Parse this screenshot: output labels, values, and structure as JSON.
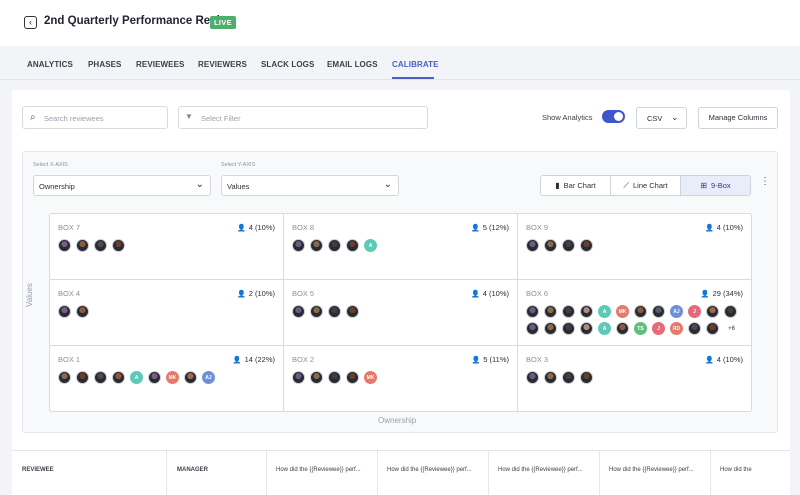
{
  "header": {
    "back_icon": "chevron-left-icon",
    "title": "2nd Quarterly Performance Review",
    "status_badge": "LIVE"
  },
  "tabs": [
    "ANALYTICS",
    "PHASES",
    "REVIEWEES",
    "REVIEWERS",
    "SLACK LOGS",
    "EMAIL LOGS",
    "CALIBRATE"
  ],
  "active_tab": "CALIBRATE",
  "toolbar": {
    "search_placeholder": "Search reviewees",
    "filter_placeholder": "Select Filter",
    "show_analytics_label": "Show Analytics",
    "show_analytics_on": true,
    "csv_label": "CSV",
    "manage_columns_label": "Manage Columns"
  },
  "chart_controls": {
    "x_axis_label": "Select X-AXIS",
    "x_axis_value": "Ownership",
    "y_axis_label": "Select Y-AXIS",
    "y_axis_value": "Values",
    "views": [
      {
        "label": "Bar Chart",
        "icon": "bar-chart-icon"
      },
      {
        "label": "Line Chart",
        "icon": "line-chart-icon"
      },
      {
        "label": "9-Box",
        "icon": "grid-icon"
      }
    ],
    "active_view": "9-Box"
  },
  "chart_data": {
    "type": "table",
    "xlabel": "Ownership",
    "ylabel": "Values",
    "boxes": [
      {
        "name": "BOX 7",
        "count": "4 (10%)",
        "avatars": [
          {
            "kind": "photo",
            "color": "#7a5c8a"
          },
          {
            "kind": "photo",
            "color": "#8a5a3a"
          },
          {
            "kind": "photo",
            "color": "#4a4a52"
          },
          {
            "kind": "photo",
            "color": "#6b3e2a"
          }
        ]
      },
      {
        "name": "BOX 8",
        "count": "5 (12%)",
        "avatars": [
          {
            "kind": "photo",
            "color": "#6a5a8a"
          },
          {
            "kind": "photo",
            "color": "#8a6a4a"
          },
          {
            "kind": "photo",
            "color": "#3e3e46"
          },
          {
            "kind": "photo",
            "color": "#6b3e2a"
          },
          {
            "kind": "initials",
            "text": "A",
            "color": "#5fc9b8"
          }
        ]
      },
      {
        "name": "BOX 9",
        "count": "4 (10%)",
        "avatars": [
          {
            "kind": "photo",
            "color": "#6a5a8a"
          },
          {
            "kind": "photo",
            "color": "#8a6a4a"
          },
          {
            "kind": "photo",
            "color": "#3e3e46"
          },
          {
            "kind": "photo",
            "color": "#6b3e2a"
          }
        ]
      },
      {
        "name": "BOX 4",
        "count": "2 (10%)",
        "avatars": [
          {
            "kind": "photo",
            "color": "#7a5c8a"
          },
          {
            "kind": "photo",
            "color": "#8a5a3a"
          }
        ]
      },
      {
        "name": "BOX 5",
        "count": "4 (10%)",
        "avatars": [
          {
            "kind": "photo",
            "color": "#6a5a8a"
          },
          {
            "kind": "photo",
            "color": "#8a6a4a"
          },
          {
            "kind": "photo",
            "color": "#3e3e46"
          },
          {
            "kind": "photo",
            "color": "#6b3e2a"
          }
        ]
      },
      {
        "name": "BOX 6",
        "count": "29 (34%)",
        "avatars": [
          {
            "kind": "photo",
            "color": "#6a5a8a"
          },
          {
            "kind": "photo",
            "color": "#8a6a4a"
          },
          {
            "kind": "photo",
            "color": "#3e3e46"
          },
          {
            "kind": "photo",
            "color": "#b08a7a"
          },
          {
            "kind": "initials",
            "text": "A",
            "color": "#5fc9b8"
          },
          {
            "kind": "initials",
            "text": "MK",
            "color": "#e57a6a"
          },
          {
            "kind": "photo",
            "color": "#8a5a3a"
          },
          {
            "kind": "photo",
            "color": "#5a5a6a"
          },
          {
            "kind": "initials",
            "text": "AJ",
            "color": "#6f8fd6"
          },
          {
            "kind": "initials",
            "text": "J",
            "color": "#e56a78"
          },
          {
            "kind": "photo",
            "color": "#a06a4a"
          },
          {
            "kind": "photo",
            "color": "#4a3a32"
          },
          {
            "kind": "photo",
            "color": "#6a5a8a"
          },
          {
            "kind": "photo",
            "color": "#8a6a4a"
          },
          {
            "kind": "photo",
            "color": "#3e3e46"
          },
          {
            "kind": "photo",
            "color": "#b08a7a"
          },
          {
            "kind": "initials",
            "text": "A",
            "color": "#5fc9b8"
          },
          {
            "kind": "photo",
            "color": "#8a5a3a"
          },
          {
            "kind": "initials",
            "text": "TS",
            "color": "#5fbf7a"
          },
          {
            "kind": "initials",
            "text": "J",
            "color": "#e56a78"
          },
          {
            "kind": "initials",
            "text": "RD",
            "color": "#e57a6a"
          },
          {
            "kind": "photo",
            "color": "#4a4a52"
          },
          {
            "kind": "photo",
            "color": "#6b3e2a"
          },
          {
            "kind": "more",
            "text": "+6"
          }
        ]
      },
      {
        "name": "BOX 1",
        "count": "14 (22%)",
        "avatars": [
          {
            "kind": "photo",
            "color": "#8a6a4a"
          },
          {
            "kind": "photo",
            "color": "#6b3e2a"
          },
          {
            "kind": "photo",
            "color": "#4a4a52"
          },
          {
            "kind": "photo",
            "color": "#8a5a3a"
          },
          {
            "kind": "initials",
            "text": "A",
            "color": "#5fc9b8"
          },
          {
            "kind": "photo",
            "color": "#7a5c8a"
          },
          {
            "kind": "initials",
            "text": "MK",
            "color": "#e57a6a"
          },
          {
            "kind": "photo",
            "color": "#a06a4a"
          },
          {
            "kind": "initials",
            "text": "AJ",
            "color": "#6f8fd6"
          }
        ]
      },
      {
        "name": "BOX 2",
        "count": "5 (11%)",
        "avatars": [
          {
            "kind": "photo",
            "color": "#6a5a8a"
          },
          {
            "kind": "photo",
            "color": "#8a6a4a"
          },
          {
            "kind": "photo",
            "color": "#3e3e46"
          },
          {
            "kind": "photo",
            "color": "#6b3e2a"
          },
          {
            "kind": "initials",
            "text": "MK",
            "color": "#e57a6a"
          }
        ]
      },
      {
        "name": "BOX 3",
        "count": "4 (10%)",
        "avatars": [
          {
            "kind": "photo",
            "color": "#6a5a8a"
          },
          {
            "kind": "photo",
            "color": "#8a6a4a"
          },
          {
            "kind": "photo",
            "color": "#3e3e46"
          },
          {
            "kind": "photo",
            "color": "#6b3e2a"
          }
        ]
      }
    ]
  },
  "table": {
    "columns": [
      "REVIEWEE",
      "MANAGER",
      "How did the {{Reviewee}} perf...",
      "How did the {{Reviewee}} perf...",
      "How did the {{Reviewee}} perf...",
      "How did the {{Reviewee}} perf...",
      "How did the"
    ]
  },
  "colors": {
    "accent": "#4a5fc1",
    "live": "#4fae6b"
  }
}
